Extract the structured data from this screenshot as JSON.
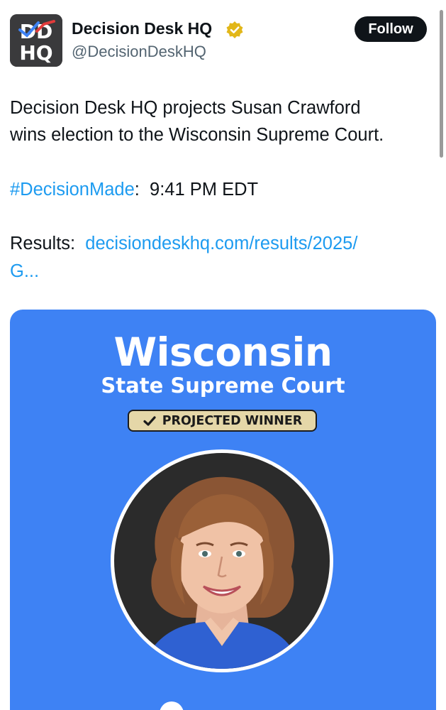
{
  "author": {
    "display_name": "Decision Desk HQ",
    "handle": "@DecisionDeskHQ",
    "verified_icon": "verified-badge-icon",
    "avatar_text_top": "DD",
    "avatar_text_bottom": "HQ"
  },
  "actions": {
    "follow_label": "Follow"
  },
  "tweet": {
    "line1": "Decision Desk HQ projects Susan Crawford",
    "line2": "wins election to the Wisconsin Supreme Court.",
    "hashtag": "#DecisionMade",
    "hashtag_sep": ":  ",
    "time": "9:41 PM EDT",
    "results_label": "Results:  ",
    "results_link_line1": "decisiondeskhq.com/results/2025/",
    "results_link_line2": "G..."
  },
  "card": {
    "title": "Wisconsin",
    "subtitle": "State Supreme Court",
    "badge_label": "PROJECTED WINNER",
    "badge_icon": "checkmark-icon",
    "portrait_icon": "candidate-portrait",
    "background_color": "#3e82f4",
    "badge_color": "#e5d7a8"
  },
  "colors": {
    "link": "#1d9bf0",
    "text": "#0f1419",
    "secondary_text": "#536471",
    "verified_gold": "#e2b719"
  }
}
